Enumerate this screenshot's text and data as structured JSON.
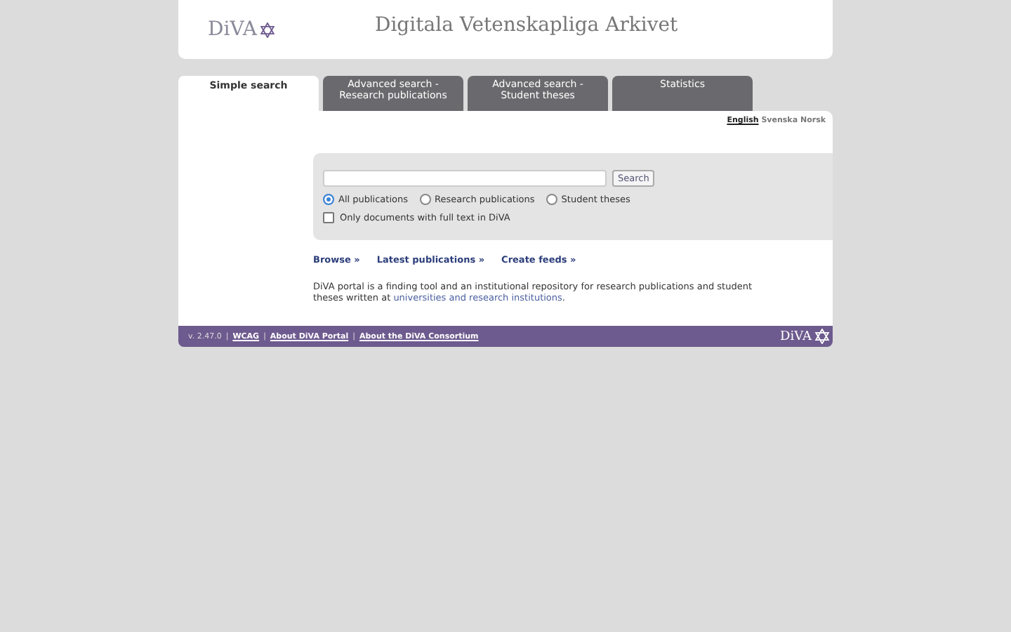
{
  "header": {
    "logo": "DiVA",
    "title": "Digitala Vetenskapliga Arkivet"
  },
  "tabs": [
    {
      "label": "Simple search",
      "selected": true
    },
    {
      "label": "Advanced search -\nResearch publications",
      "selected": false
    },
    {
      "label": "Advanced search -\nStudent theses",
      "selected": false
    },
    {
      "label": "Statistics",
      "selected": false
    }
  ],
  "languages": [
    {
      "label": "English",
      "selected": true
    },
    {
      "label": "Svenska",
      "selected": false
    },
    {
      "label": "Norsk",
      "selected": false
    }
  ],
  "search": {
    "button": "Search",
    "scopes": [
      {
        "label": "All publications",
        "selected": true
      },
      {
        "label": "Research publications",
        "selected": false
      },
      {
        "label": "Student theses",
        "selected": false
      }
    ],
    "fulltext": {
      "label": "Only documents with full text in DiVA",
      "checked": false
    }
  },
  "links": [
    "Browse »",
    "Latest publications »",
    "Create feeds »"
  ],
  "intro": {
    "text": "DiVA portal is a finding tool and an institutional repository for research publications and student theses written at",
    "link": "universities and research institutions",
    "end": "."
  },
  "footer": {
    "version": "v. 2.47.0",
    "links": [
      "WCAG",
      "About DiVA Portal",
      "About the DiVA Consortium"
    ],
    "separator": "|",
    "logo": "DiVA"
  }
}
